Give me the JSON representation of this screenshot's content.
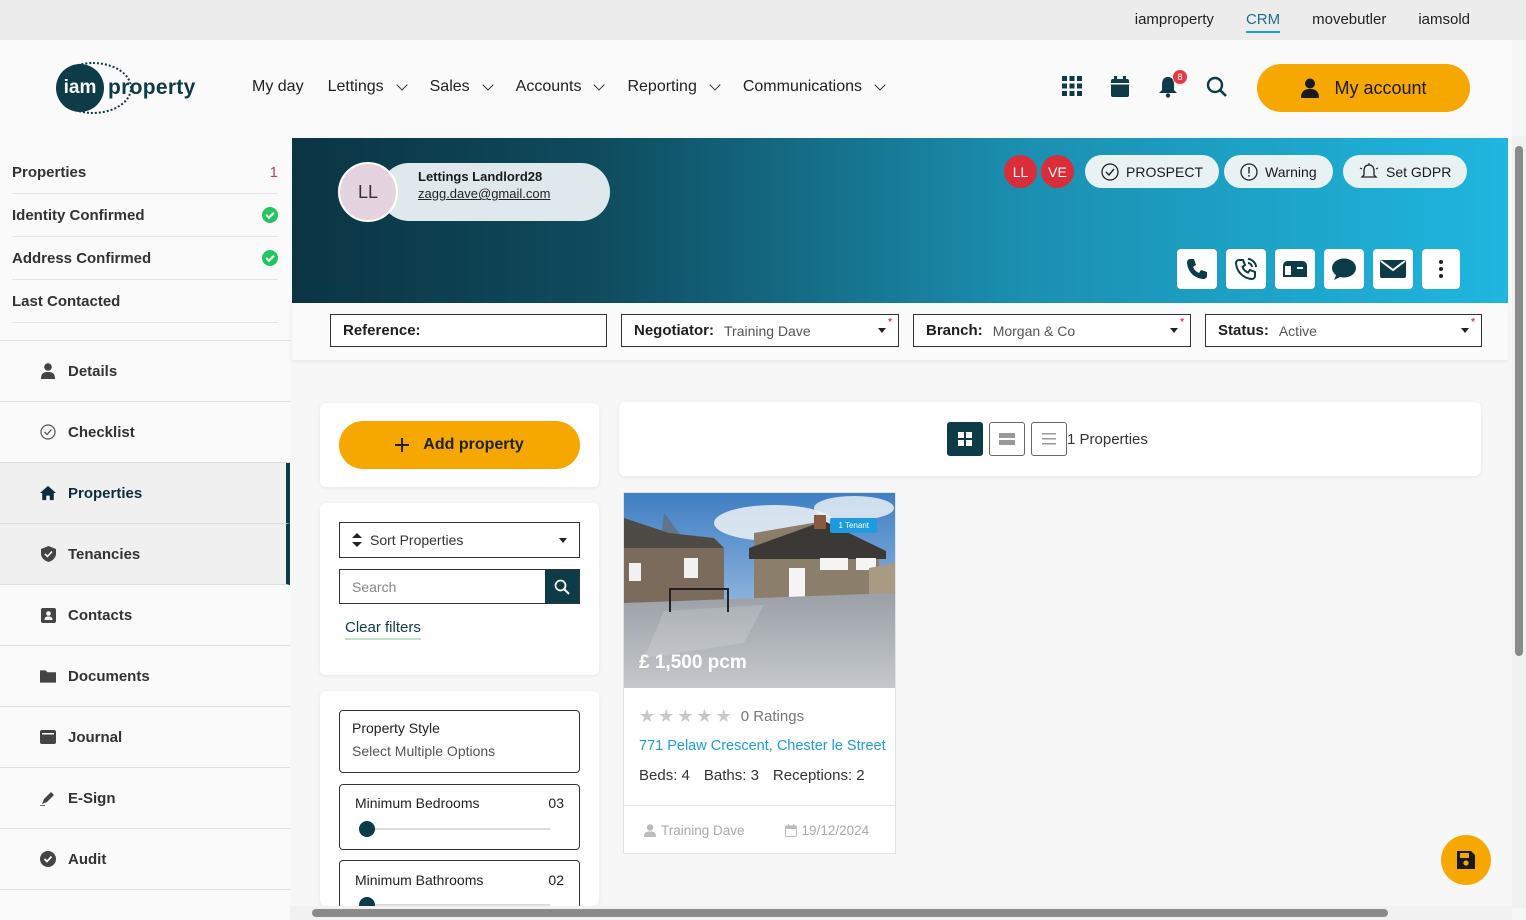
{
  "top_links": [
    "iamproperty",
    "CRM",
    "movebutler",
    "iamsold"
  ],
  "logo": {
    "mark": "iam",
    "text": "property"
  },
  "main_nav": [
    "My day",
    "Lettings",
    "Sales",
    "Accounts",
    "Reporting",
    "Communications"
  ],
  "notifications_count": "8",
  "my_account_label": "My account",
  "stats": [
    {
      "label": "Properties",
      "value": "1"
    },
    {
      "label": "Identity Confirmed",
      "value": ""
    },
    {
      "label": "Address Confirmed",
      "value": ""
    },
    {
      "label": "Last Contacted",
      "value": ""
    }
  ],
  "side_nav": [
    "Details",
    "Checklist",
    "Properties",
    "Tenancies",
    "Contacts",
    "Documents",
    "Journal",
    "E-Sign",
    "Audit"
  ],
  "profile": {
    "initials": "LL",
    "name": "Lettings Landlord28",
    "email": "zagg.dave@gmail.com"
  },
  "user_initials": [
    "LL",
    "VE"
  ],
  "pills": {
    "prospect": "PROSPECT",
    "warning": "Warning",
    "gdpr": "Set GDPR"
  },
  "filters": {
    "reference_label": "Reference:",
    "negotiator_label": "Negotiator:",
    "negotiator_value": "Training Dave",
    "branch_label": "Branch:",
    "branch_value": "Morgan & Co",
    "status_label": "Status:",
    "status_value": "Active"
  },
  "add_property_label": "Add property",
  "sort_label": "Sort Properties",
  "search_placeholder": "Search",
  "clear_filters": "Clear filters",
  "property_style": {
    "title": "Property Style",
    "placeholder": "Select Multiple Options"
  },
  "min_bedrooms": {
    "label": "Minimum Bedrooms",
    "value": "03"
  },
  "min_bathrooms": {
    "label": "Minimum Bathrooms",
    "value": "02"
  },
  "results_count": "1 Properties",
  "property": {
    "price": "£ 1,500 pcm",
    "tenant_badge": "1 Tenant",
    "ratings": "0 Ratings",
    "address": "771 Pelaw Crescent, Chester le Street",
    "beds": "Beds: 4",
    "baths": "Baths: 3",
    "receptions": "Receptions: 2",
    "negotiator": "Training Dave",
    "date": "19/12/2024"
  },
  "colors": {
    "accent": "#f7a800",
    "dark": "#0d3b47",
    "link": "#1e9be0",
    "alert": "#d92d3a"
  }
}
